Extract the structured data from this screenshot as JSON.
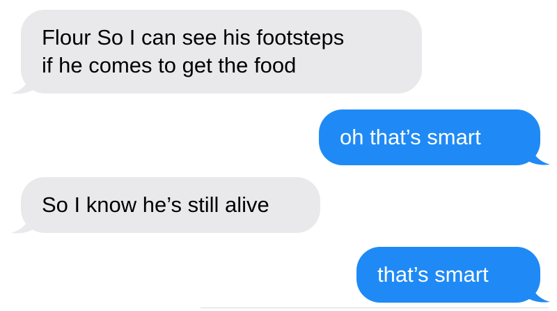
{
  "conversation": {
    "messages": [
      {
        "direction": "incoming",
        "lines": [
          "Flour So I can see his footsteps",
          "if he comes to get the food"
        ]
      },
      {
        "direction": "outgoing",
        "lines": [
          "oh that’s smart"
        ]
      },
      {
        "direction": "incoming",
        "lines": [
          "So I know he’s still alive"
        ]
      },
      {
        "direction": "outgoing",
        "lines": [
          "that’s smart"
        ]
      }
    ]
  },
  "colors": {
    "incoming_bubble": "#e9e9eb",
    "incoming_text": "#000000",
    "outgoing_bubble": "#1f8af5",
    "outgoing_text": "#ffffff",
    "background": "#ffffff"
  }
}
